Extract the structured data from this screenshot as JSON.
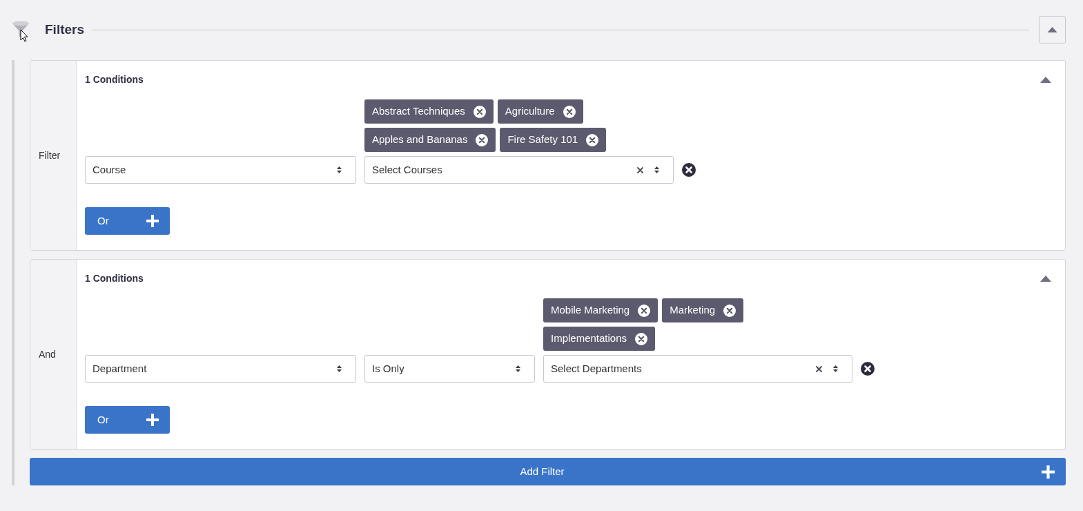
{
  "header": {
    "title": "Filters",
    "expanded": true
  },
  "groups": [
    {
      "label": "Filter",
      "title": "1 Conditions",
      "expanded": true,
      "conditions": [
        {
          "field": "Course",
          "tags": [
            "Abstract Techniques",
            "Agriculture",
            "Apples and Bananas",
            "Fire Safety 101"
          ],
          "placeholder": "Select Courses"
        }
      ],
      "or_button": "Or"
    },
    {
      "label": "And",
      "title": "1 Conditions",
      "expanded": true,
      "conditions": [
        {
          "field": "Department",
          "operator": "Is Only",
          "tags": [
            "Mobile Marketing",
            "Marketing",
            "Implementations"
          ],
          "placeholder": "Select Departments"
        }
      ],
      "or_button": "Or"
    }
  ],
  "add_filter_button": "Add Filter"
}
